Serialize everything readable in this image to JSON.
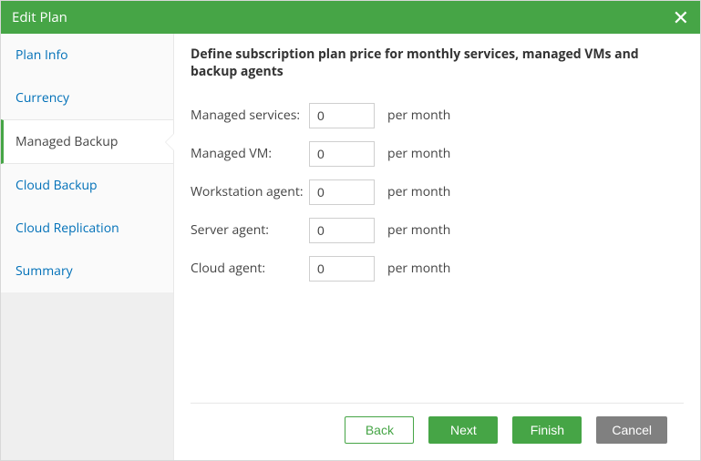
{
  "titlebar": {
    "title": "Edit Plan",
    "close_glyph": "✕"
  },
  "sidebar": {
    "items": [
      {
        "label": "Plan Info"
      },
      {
        "label": "Currency"
      },
      {
        "label": "Managed Backup",
        "active": true
      },
      {
        "label": "Cloud Backup"
      },
      {
        "label": "Cloud Replication"
      },
      {
        "label": "Summary"
      }
    ]
  },
  "main": {
    "heading": "Define subscription plan price for monthly services, managed VMs and backup agents",
    "unit_suffix": "per month",
    "fields": {
      "managed_services": {
        "label": "Managed services:",
        "value": "0"
      },
      "managed_vm": {
        "label": "Managed VM:",
        "value": "0"
      },
      "workstation_agent": {
        "label": "Workstation agent:",
        "value": "0"
      },
      "server_agent": {
        "label": "Server agent:",
        "value": "0"
      },
      "cloud_agent": {
        "label": "Cloud agent:",
        "value": "0"
      }
    }
  },
  "footer": {
    "back": "Back",
    "next": "Next",
    "finish": "Finish",
    "cancel": "Cancel"
  },
  "colors": {
    "brand_green": "#46a546",
    "link_blue": "#0070b8",
    "cancel_grey": "#808080"
  }
}
